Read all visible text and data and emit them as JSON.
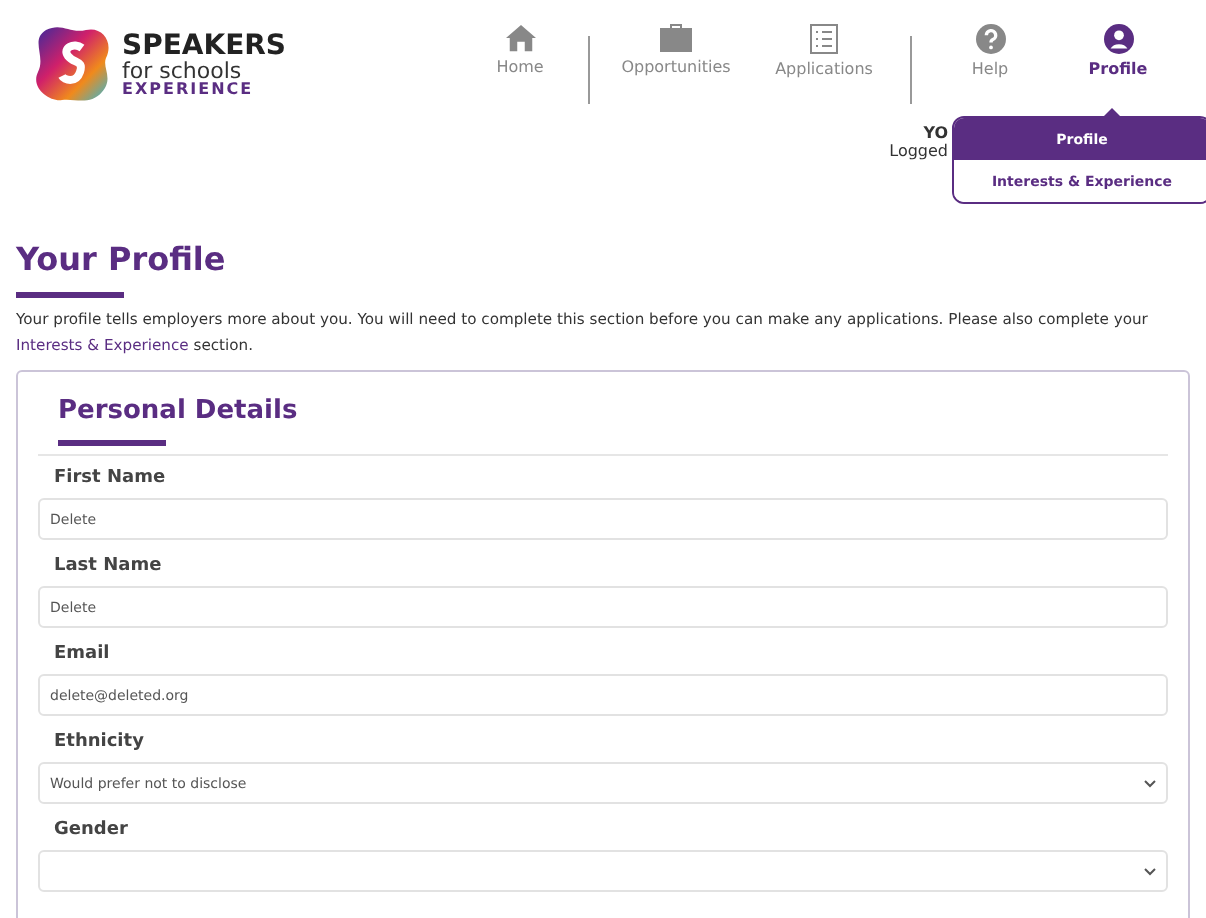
{
  "logo": {
    "line1": "SPEAKERS",
    "line2": "for schools",
    "line3": "EXPERIENCE"
  },
  "nav": [
    {
      "label": "Home",
      "kind": "home",
      "selected": false
    },
    {
      "label": "Opportunities",
      "kind": "briefcase",
      "selected": false
    },
    {
      "label": "Applications",
      "kind": "list",
      "selected": false
    },
    {
      "label": "Help",
      "kind": "help",
      "selected": false
    },
    {
      "label": "Profile",
      "kind": "user",
      "selected": true
    }
  ],
  "user": {
    "line1": "YO",
    "line2": "Logged"
  },
  "profile_menu": [
    {
      "label": "Profile",
      "selected": true
    },
    {
      "label": "Interests & Experience",
      "selected": false
    }
  ],
  "page": {
    "title": "Your Profile",
    "intro_before": "Your profile tells employers more about you. You will need to complete this section before you can make any applications. Please also complete your",
    "intro_link": "Interests & Experience",
    "intro_after": "section."
  },
  "card": {
    "title": "Personal Details",
    "fields": [
      {
        "label": "First Name",
        "kind": "text",
        "value": "Delete"
      },
      {
        "label": "Last Name",
        "kind": "text",
        "value": "Delete"
      },
      {
        "label": "Email",
        "kind": "text",
        "value": "delete@deleted.org"
      },
      {
        "label": "Ethnicity",
        "kind": "select",
        "value": "Would prefer not to disclose"
      },
      {
        "label": "Gender",
        "kind": "select"
      }
    ]
  }
}
